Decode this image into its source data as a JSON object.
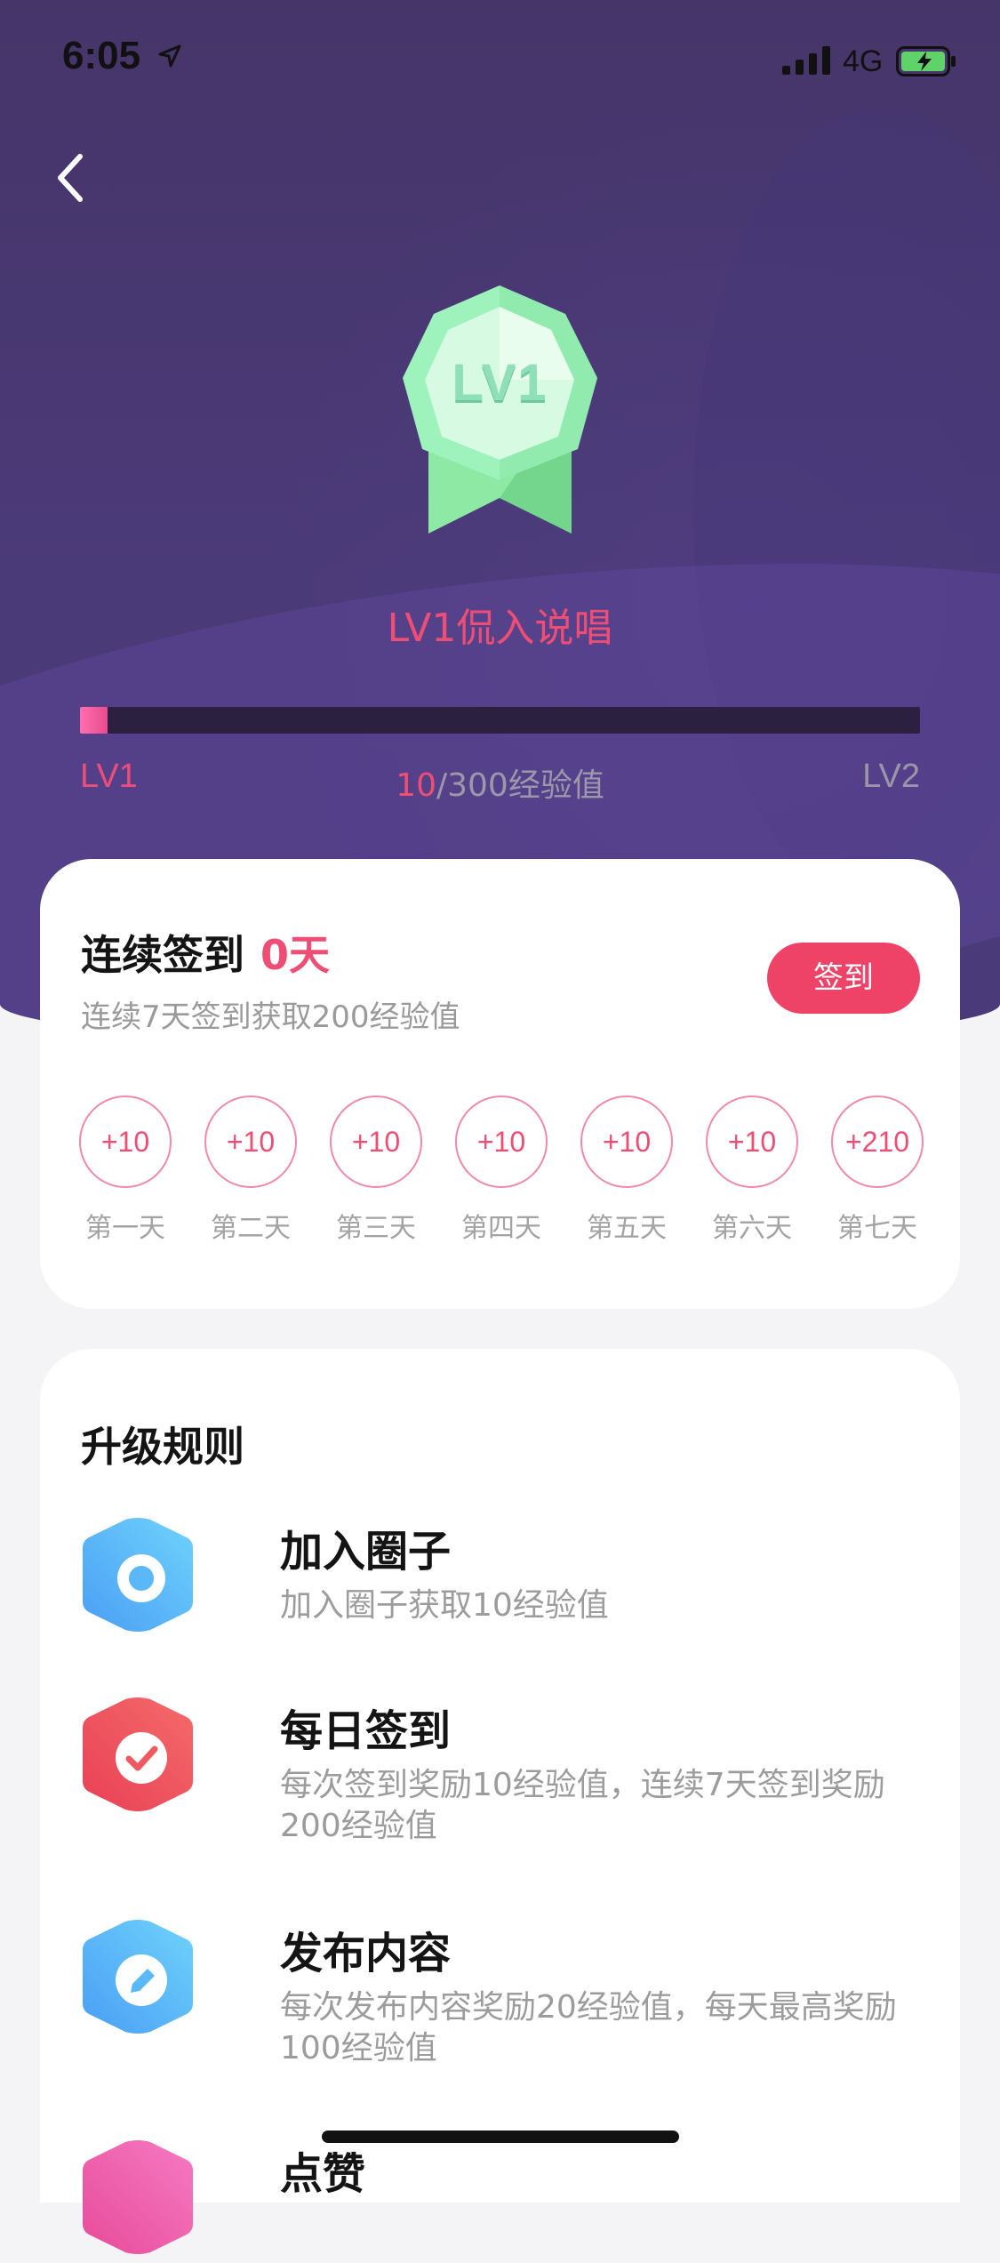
{
  "status_bar": {
    "time": "6:05",
    "network": "4G",
    "icons": [
      "location-arrow-icon",
      "signal-bars-icon",
      "battery-charging-icon"
    ]
  },
  "header": {
    "back_icon": "chevron-left-icon"
  },
  "level": {
    "badge_text": "LV1",
    "title": "LV1侃入说唱",
    "current_level": "LV1",
    "next_level": "LV2",
    "exp_current": "10",
    "exp_total_text": "/300经验值",
    "progress_fraction": 0.0333
  },
  "checkin": {
    "title": "连续签到",
    "days": "0天",
    "subtitle": "连续7天签到获取200经验值",
    "button_label": "签到",
    "rewards": [
      {
        "value": "+10",
        "label": "第一天"
      },
      {
        "value": "+10",
        "label": "第二天"
      },
      {
        "value": "+10",
        "label": "第三天"
      },
      {
        "value": "+10",
        "label": "第四天"
      },
      {
        "value": "+10",
        "label": "第五天"
      },
      {
        "value": "+10",
        "label": "第六天"
      },
      {
        "value": "+210",
        "label": "第七天"
      }
    ]
  },
  "rules": {
    "title": "升级规则",
    "items": [
      {
        "title": "加入圈子",
        "desc": "加入圈子获取10经验值",
        "icon": "circle-target-icon",
        "color": "#5ab8f8"
      },
      {
        "title": "每日签到",
        "desc": "每次签到奖励10经验值，连续7天签到奖励200经验值",
        "icon": "checkmark-icon",
        "color": "#ee5a5f"
      },
      {
        "title": "发布内容",
        "desc": "每次发布内容奖励20经验值，每天最高奖励100经验值",
        "icon": "pencil-icon",
        "color": "#5ab8f8"
      },
      {
        "title": "点赞",
        "desc": "",
        "icon": "like-icon",
        "color": "#ee5aa8"
      }
    ]
  },
  "colors": {
    "accent": "#ef4e74",
    "hero_bg": "#473770"
  }
}
